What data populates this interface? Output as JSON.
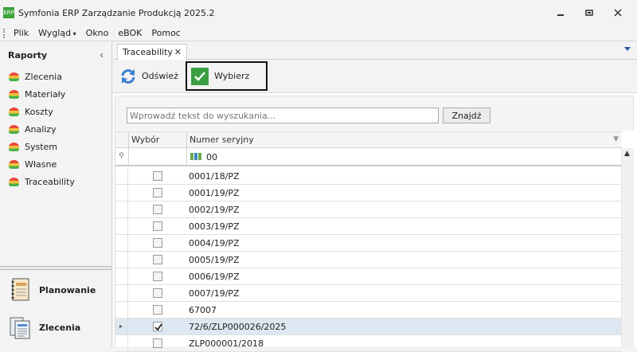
{
  "window": {
    "title": "Symfonia ERP Zarządzanie Produkcją 2025.2",
    "controls": [
      "minimize",
      "restore",
      "close"
    ]
  },
  "menu": {
    "items": [
      "Plik",
      "Wygląd",
      "Okno",
      "eBOK",
      "Pomoc"
    ]
  },
  "sidebar": {
    "title": "Raporty",
    "items": [
      "Zlecenia",
      "Materiały",
      "Koszty",
      "Analizy",
      "System",
      "Własne",
      "Traceability"
    ],
    "modules": [
      "Planowanie",
      "Zlecenia"
    ]
  },
  "tabs": [
    {
      "label": "Traceability"
    }
  ],
  "toolbar": {
    "refresh_label": "Odśwież",
    "choose_label": "Wybierz"
  },
  "search": {
    "placeholder": "Wprowadź tekst do wyszukania...",
    "button": "Znajdź"
  },
  "grid": {
    "columns": [
      "Wybór",
      "Numer seryjny"
    ],
    "filter_value": "00",
    "rows": [
      {
        "serial": "0001/18/PZ",
        "checked": false
      },
      {
        "serial": "0001/19/PZ",
        "checked": false
      },
      {
        "serial": "0002/19/PZ",
        "checked": false
      },
      {
        "serial": "0003/19/PZ",
        "checked": false
      },
      {
        "serial": "0004/19/PZ",
        "checked": false
      },
      {
        "serial": "0005/19/PZ",
        "checked": false
      },
      {
        "serial": "0006/19/PZ",
        "checked": false
      },
      {
        "serial": "0007/19/PZ",
        "checked": false
      },
      {
        "serial": "67007",
        "checked": false
      },
      {
        "serial": "72/6/ZLP000026/2025",
        "checked": true,
        "selected": true
      },
      {
        "serial": "ZLP000001/2018",
        "checked": false
      }
    ]
  }
}
